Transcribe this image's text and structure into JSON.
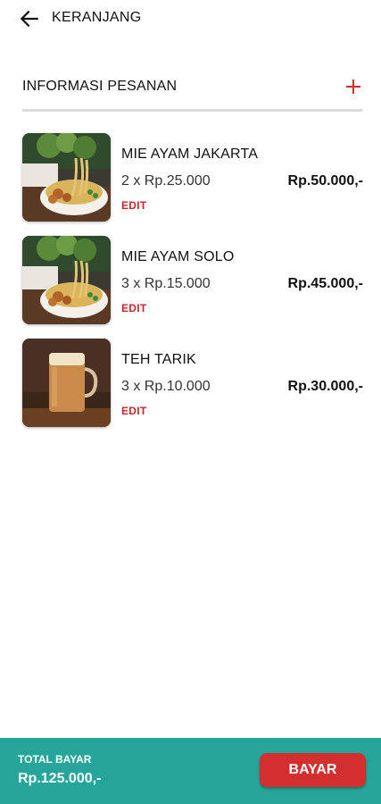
{
  "header": {
    "title": "KERANJANG",
    "back_icon": "arrow-left-icon"
  },
  "order_section": {
    "title": "INFORMASI PESANAN",
    "add_icon": "plus-icon"
  },
  "items": [
    {
      "name": "MIE AYAM JAKARTA",
      "qty_price": "2 x Rp.25.000",
      "subtotal": "Rp.50.000,-",
      "edit_label": "EDIT",
      "image": "mie-ayam-photo"
    },
    {
      "name": "MIE AYAM SOLO",
      "qty_price": "3 x Rp.15.000",
      "subtotal": "Rp.45.000,-",
      "edit_label": "EDIT",
      "image": "mie-ayam-photo"
    },
    {
      "name": "TEH TARIK",
      "qty_price": "3 x Rp.10.000",
      "subtotal": "Rp.30.000,-",
      "edit_label": "EDIT",
      "image": "teh-tarik-photo"
    }
  ],
  "footer": {
    "total_label": "TOTAL BAYAR",
    "total_value": "Rp.125.000,-",
    "pay_label": "BAYAR"
  },
  "colors": {
    "accent_red": "#d32f2f",
    "footer_teal": "#26a69a",
    "edit_red": "#c7262e"
  }
}
